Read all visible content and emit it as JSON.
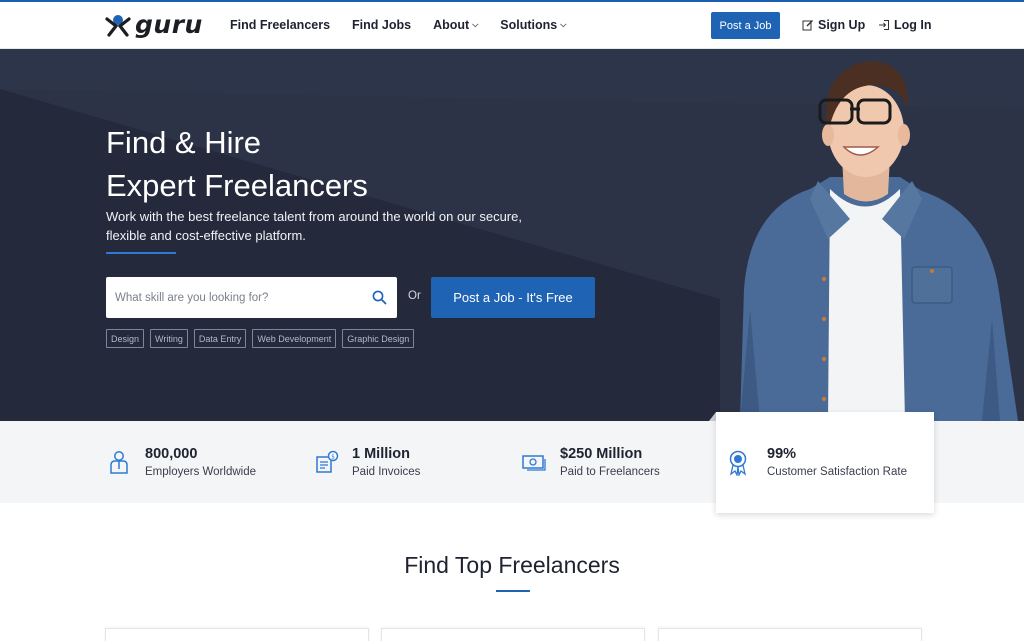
{
  "brand": {
    "logo_text": "guru"
  },
  "nav": {
    "items": [
      {
        "label": "Find Freelancers",
        "has_caret": false
      },
      {
        "label": "Find Jobs",
        "has_caret": false
      },
      {
        "label": "About",
        "has_caret": true
      },
      {
        "label": "Solutions",
        "has_caret": true
      }
    ],
    "post_job_label": "Post a Job",
    "signup_label": "Sign Up",
    "login_label": "Log In"
  },
  "hero": {
    "title_line1": "Find & Hire",
    "title_line2": "Expert Freelancers",
    "subtitle": "Work with the best freelance talent from around the world on our secure, flexible and cost-effective platform.",
    "search_placeholder": "What skill are you looking for?",
    "or_text": "Or",
    "cta_label": "Post a Job - It's Free",
    "tags": [
      "Design",
      "Writing",
      "Data Entry",
      "Web Development",
      "Graphic Design"
    ]
  },
  "stats": [
    {
      "value": "800,000",
      "label": "Employers Worldwide",
      "icon": "employer-icon"
    },
    {
      "value": "1 Million",
      "label": "Paid Invoices",
      "icon": "invoice-icon"
    },
    {
      "value": "$250 Million",
      "label": "Paid to Freelancers",
      "icon": "money-icon"
    },
    {
      "value": "99%",
      "label": "Customer Satisfaction Rate",
      "icon": "award-ribbon-icon"
    }
  ],
  "section": {
    "title": "Find Top Freelancers"
  },
  "colors": {
    "accent": "#1f63b5",
    "hero_bg": "#2c3347",
    "stats_bg": "#f4f5f7"
  }
}
